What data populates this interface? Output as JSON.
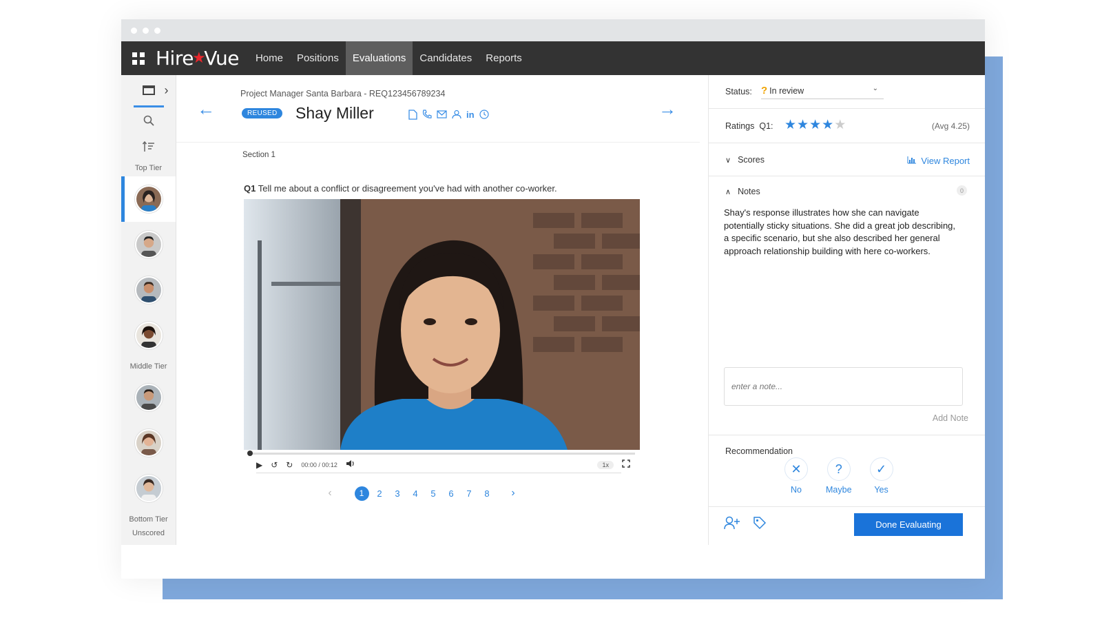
{
  "nav": {
    "logo_left": "Hire",
    "logo_right": "Vue",
    "items": [
      "Home",
      "Positions",
      "Evaluations",
      "Candidates",
      "Reports"
    ],
    "active": "Evaluations"
  },
  "rail": {
    "tiers": {
      "top": "Top Tier",
      "middle": "Middle Tier",
      "bottom": "Bottom Tier",
      "unscored": "Unscored"
    }
  },
  "candidate": {
    "project": "Project Manager Santa Barbara - REQ123456789234",
    "badge": "REUSED",
    "name": "Shay Miller"
  },
  "section": "Section 1",
  "question": {
    "number": "Q1",
    "text": "Tell me about a conflict or disagreement you've had with another co-worker."
  },
  "player": {
    "time": "00:00 / 00:12",
    "speed": "1x",
    "progress": 0
  },
  "pagination": {
    "pages": [
      "1",
      "2",
      "3",
      "4",
      "5",
      "6",
      "7",
      "8"
    ],
    "current": "1"
  },
  "panel": {
    "status_label": "Status:",
    "status_value": "In review",
    "ratings_label": "Ratings",
    "ratings_q": "Q1:",
    "rating": 4,
    "rating_max": 5,
    "avg": "(Avg 4.25)",
    "scores_label": "Scores",
    "view_report": "View Report",
    "notes_label": "Notes",
    "notes_count": "0",
    "notes_text": "Shay's response illustrates how she can navigate potentially sticky situations. She did a great job describing, a specific scenario, but she also described her general approach relationship building with here co-workers.",
    "note_placeholder": "enter a note...",
    "add_note": "Add Note",
    "recommendation_label": "Recommendation",
    "recommendations": [
      {
        "label": "No",
        "icon": "✕"
      },
      {
        "label": "Maybe",
        "icon": "?"
      },
      {
        "label": "Yes",
        "icon": "✓"
      }
    ],
    "done_button": "Done Evaluating"
  },
  "colors": {
    "accent": "#2e86de",
    "navbar": "#333333",
    "status_warning": "#f0a300",
    "backdrop": "#7fa8dc"
  }
}
